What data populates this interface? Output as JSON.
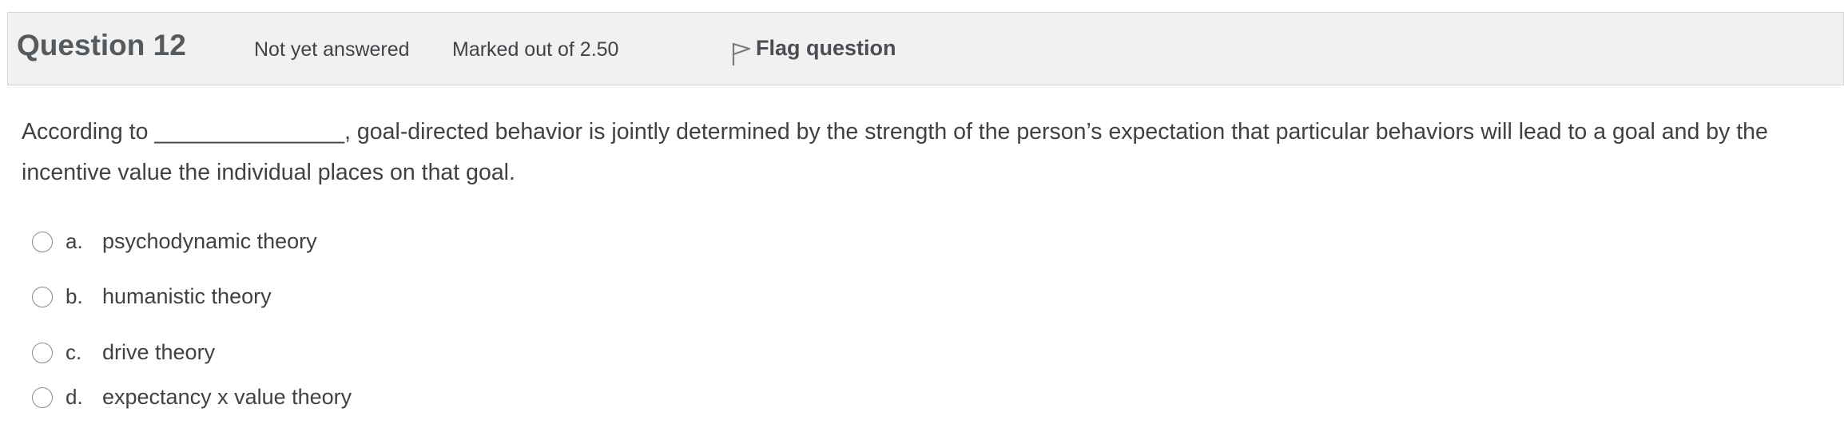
{
  "question": {
    "title": "Question 12",
    "status": "Not yet answered",
    "mark": "Marked out of 2.50",
    "flag_label": "Flag question",
    "flag_icon": "flag-icon",
    "text": "According to _______________, goal-directed behavior is jointly determined by the strength of the person’s expectation that particular behaviors will lead to a goal and by the incentive value the individual places on that goal."
  },
  "answers": [
    {
      "letter": "a.",
      "text": "psychodynamic theory",
      "selected": false
    },
    {
      "letter": "b.",
      "text": "humanistic theory",
      "selected": false
    },
    {
      "letter": "c.",
      "text": "drive theory",
      "selected": false
    },
    {
      "letter": "d.",
      "text": "expectancy x value theory",
      "selected": false
    }
  ]
}
